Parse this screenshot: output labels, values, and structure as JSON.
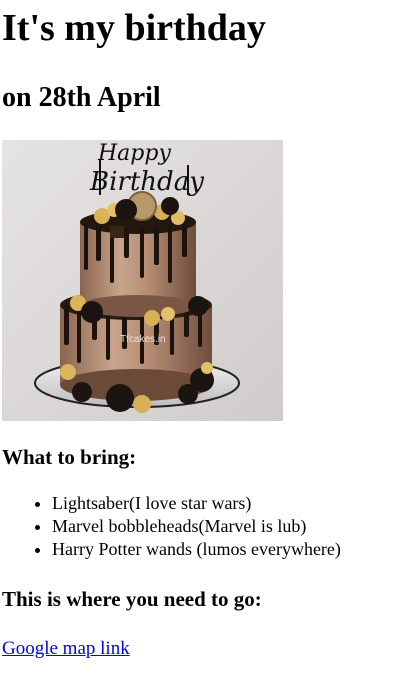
{
  "header": {
    "title": "It's my birthday",
    "subtitle": "on 28th April"
  },
  "image": {
    "topper_text": "Happy Birthday",
    "watermark": "Tfcakes.in"
  },
  "bring": {
    "heading": "What to bring:",
    "items": [
      "Lightsaber(I love star wars)",
      "Marvel bobbleheads(Marvel is lub)",
      "Harry Potter wands (lumos everywhere)"
    ]
  },
  "location": {
    "heading": "This is where you need to go:",
    "link_text": "Google map link"
  },
  "colors": {
    "link": "#0000ee",
    "text": "#000000",
    "background": "#ffffff"
  }
}
